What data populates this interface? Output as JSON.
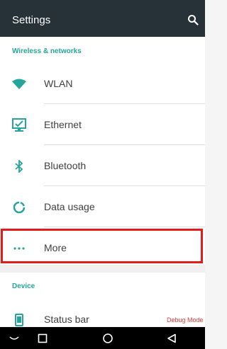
{
  "appbar": {
    "title": "Settings",
    "search_icon": "search-icon"
  },
  "wireless": {
    "header": "Wireless & networks",
    "items": [
      {
        "label": "WLAN",
        "icon": "wifi-icon"
      },
      {
        "label": "Ethernet",
        "icon": "ethernet-icon"
      },
      {
        "label": "Bluetooth",
        "icon": "bluetooth-icon"
      },
      {
        "label": "Data usage",
        "icon": "data-usage-icon"
      },
      {
        "label": "More",
        "icon": "more-dots-icon"
      }
    ]
  },
  "device": {
    "header": "Device",
    "items": [
      {
        "label": "Status bar",
        "icon": "phone-icon",
        "badge": "Debug Mode"
      }
    ]
  },
  "navbar": {
    "icons": [
      "collapse-icon",
      "recents-icon",
      "home-icon",
      "back-icon"
    ]
  },
  "colors": {
    "appbar": "#263238",
    "accent": "#26a69a",
    "highlight": "#e31b1b",
    "badge": "#e53935"
  }
}
